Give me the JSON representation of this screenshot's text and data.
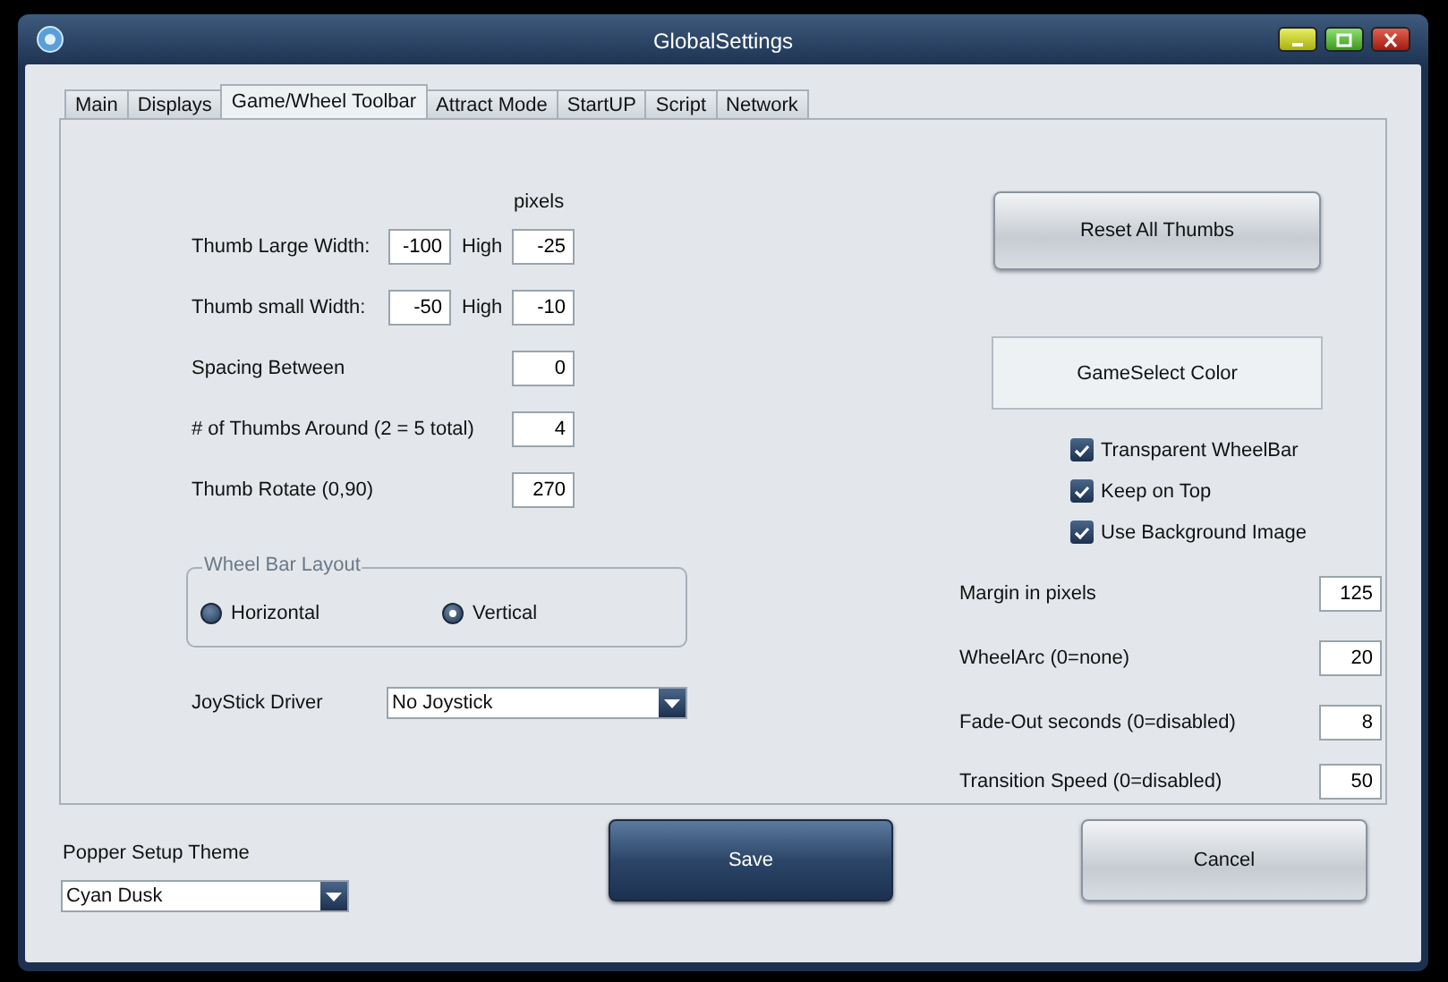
{
  "window": {
    "title": "GlobalSettings"
  },
  "tabs": [
    {
      "label": "Main",
      "selected": false
    },
    {
      "label": "Displays",
      "selected": false
    },
    {
      "label": "Game/Wheel Toolbar",
      "selected": true
    },
    {
      "label": "Attract Mode",
      "selected": false
    },
    {
      "label": "StartUP",
      "selected": false
    },
    {
      "label": "Script",
      "selected": false
    },
    {
      "label": "Network",
      "selected": false
    }
  ],
  "pixels_label": "pixels",
  "thumb_fields": [
    {
      "kind": "pair",
      "label": "Thumb Large Width:",
      "value": "-100",
      "high_label": "High",
      "high_value": "-25"
    },
    {
      "kind": "pair",
      "label": "Thumb small Width:",
      "value": "-50",
      "high_label": "High",
      "high_value": "-10"
    },
    {
      "kind": "single",
      "label": "Spacing Between",
      "value": "0"
    },
    {
      "kind": "single",
      "label": "# of Thumbs Around (2 = 5 total)",
      "value": "4"
    },
    {
      "kind": "single",
      "label": "Thumb Rotate (0,90)",
      "value": "270"
    }
  ],
  "wheel_bar_layout": {
    "title": "Wheel Bar Layout",
    "options": [
      {
        "label": "Horizontal",
        "selected": false
      },
      {
        "label": "Vertical",
        "selected": true
      }
    ]
  },
  "joystick": {
    "label": "JoyStick Driver",
    "value": "No Joystick"
  },
  "reset_button": "Reset All Thumbs",
  "color_button": "GameSelect Color",
  "checkboxes": [
    {
      "label": "Transparent WheelBar",
      "checked": true
    },
    {
      "label": "Keep on Top",
      "checked": true
    },
    {
      "label": "Use Background Image",
      "checked": true
    }
  ],
  "wheel_fields": [
    {
      "label": "Margin in pixels",
      "value": "125"
    },
    {
      "label": "WheelArc (0=none)",
      "value": "20"
    },
    {
      "label": "Fade-Out seconds (0=disabled)",
      "value": "8"
    },
    {
      "label": "Transition Speed  (0=disabled)",
      "value": "50"
    }
  ],
  "theme": {
    "label": "Popper Setup Theme",
    "value": "Cyan Dusk"
  },
  "buttons": [
    {
      "kind": "primary",
      "label": "Save"
    },
    {
      "kind": "secondary",
      "label": "Cancel"
    }
  ]
}
